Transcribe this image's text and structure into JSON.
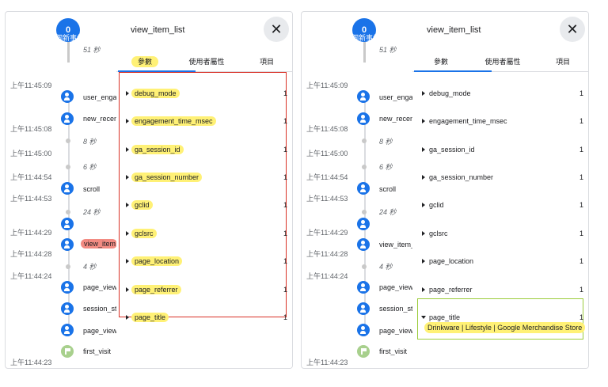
{
  "stream": {
    "badge_count": "0",
    "badge_sub": "個新事件",
    "top_gap": "51 秒",
    "timestamps": [
      "上午11:45:09",
      "上午11:45:08",
      "上午11:45:00",
      "上午11:44:54",
      "上午11:44:53",
      "上午11:44:29",
      "上午11:44:28",
      "上午11:44:24",
      "上午11:44:23"
    ],
    "events": [
      "user_engag",
      "new_recent",
      "scroll",
      "view_item_",
      "page_view",
      "session_st",
      "page_view",
      "first_visit"
    ],
    "gaps": [
      "8 秒",
      "6 秒",
      "24 秒",
      "4 秒"
    ]
  },
  "drawer": {
    "title": "view_item_list",
    "close_icon": "close-icon",
    "tabs": [
      "參數",
      "使用者屬性",
      "項目"
    ],
    "params": [
      {
        "name": "debug_mode",
        "count": "1"
      },
      {
        "name": "engagement_time_msec",
        "count": "1"
      },
      {
        "name": "ga_session_id",
        "count": "1"
      },
      {
        "name": "ga_session_number",
        "count": "1"
      },
      {
        "name": "gclid",
        "count": "1"
      },
      {
        "name": "gclsrc",
        "count": "1"
      },
      {
        "name": "page_location",
        "count": "1"
      },
      {
        "name": "page_referrer",
        "count": "1"
      },
      {
        "name": "page_title",
        "count": "1"
      }
    ],
    "page_title_value": "Drinkware | Lifestyle | Google Merchandise Store"
  },
  "colors": {
    "accent": "#1a73e8",
    "highlight": "#fff176",
    "red_box": "#d93025",
    "green_box": "#9ccc3c",
    "event_highlight": "#f28b82"
  }
}
